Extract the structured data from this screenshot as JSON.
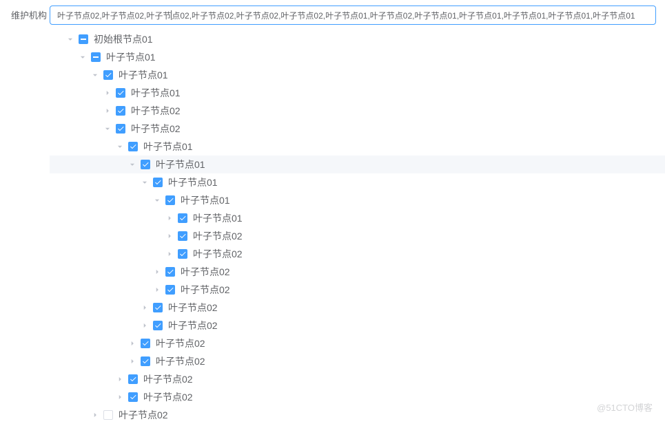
{
  "label": "维护机构",
  "input_value": "叶子节点02,叶子节点02,叶子节|点02,叶子节点02,叶子节点02,叶子节点02,叶子节点01,叶子节点02,叶子节点01,叶子节点01,叶子节点01,叶子节点01,叶子节点01",
  "watermark": "@51CTO博客",
  "tree": [
    {
      "indent": 0,
      "toggle": "expanded",
      "check": "indeterminate",
      "label": "初始根节点01",
      "hl": false
    },
    {
      "indent": 1,
      "toggle": "expanded",
      "check": "indeterminate",
      "label": "叶子节点01",
      "hl": false
    },
    {
      "indent": 2,
      "toggle": "expanded",
      "check": "checked",
      "label": "叶子节点01",
      "hl": false
    },
    {
      "indent": 3,
      "toggle": "collapsed",
      "check": "checked",
      "label": "叶子节点01",
      "hl": false
    },
    {
      "indent": 3,
      "toggle": "collapsed",
      "check": "checked",
      "label": "叶子节点02",
      "hl": false
    },
    {
      "indent": 3,
      "toggle": "expanded",
      "check": "checked",
      "label": "叶子节点02",
      "hl": false
    },
    {
      "indent": 4,
      "toggle": "expanded",
      "check": "checked",
      "label": "叶子节点01",
      "hl": false
    },
    {
      "indent": 5,
      "toggle": "expanded",
      "check": "checked",
      "label": "叶子节点01",
      "hl": true
    },
    {
      "indent": 6,
      "toggle": "expanded",
      "check": "checked",
      "label": "叶子节点01",
      "hl": false
    },
    {
      "indent": 7,
      "toggle": "expanded",
      "check": "checked",
      "label": "叶子节点01",
      "hl": false
    },
    {
      "indent": 8,
      "toggle": "collapsed",
      "check": "checked",
      "label": "叶子节点01",
      "hl": false
    },
    {
      "indent": 8,
      "toggle": "collapsed",
      "check": "checked",
      "label": "叶子节点02",
      "hl": false
    },
    {
      "indent": 8,
      "toggle": "collapsed",
      "check": "checked",
      "label": "叶子节点02",
      "hl": false
    },
    {
      "indent": 7,
      "toggle": "collapsed",
      "check": "checked",
      "label": "叶子节点02",
      "hl": false
    },
    {
      "indent": 7,
      "toggle": "collapsed",
      "check": "checked",
      "label": "叶子节点02",
      "hl": false
    },
    {
      "indent": 6,
      "toggle": "collapsed",
      "check": "checked",
      "label": "叶子节点02",
      "hl": false
    },
    {
      "indent": 6,
      "toggle": "collapsed",
      "check": "checked",
      "label": "叶子节点02",
      "hl": false
    },
    {
      "indent": 5,
      "toggle": "collapsed",
      "check": "checked",
      "label": "叶子节点02",
      "hl": false
    },
    {
      "indent": 5,
      "toggle": "collapsed",
      "check": "checked",
      "label": "叶子节点02",
      "hl": false
    },
    {
      "indent": 4,
      "toggle": "collapsed",
      "check": "checked",
      "label": "叶子节点02",
      "hl": false
    },
    {
      "indent": 4,
      "toggle": "collapsed",
      "check": "checked",
      "label": "叶子节点02",
      "hl": false
    },
    {
      "indent": 2,
      "toggle": "collapsed",
      "check": "unchecked",
      "label": "叶子节点02",
      "hl": false
    }
  ]
}
